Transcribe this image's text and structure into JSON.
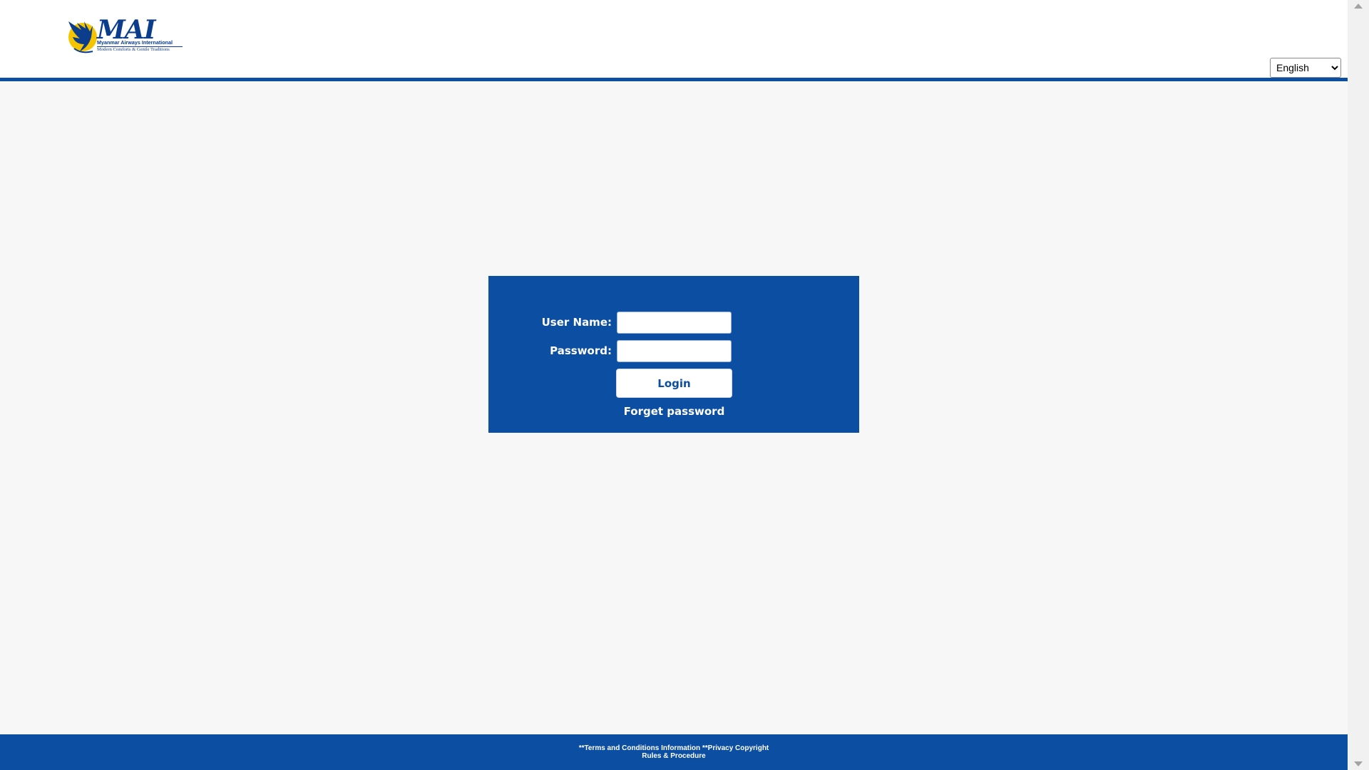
{
  "logo": {
    "wordmark": "MAI",
    "line1": "Myanmar Airways International",
    "line2": "Modern Comforts & Gentle Traditions",
    "icon": "winged-bird-logo-icon"
  },
  "language": {
    "selected": "English",
    "options": [
      "English"
    ]
  },
  "login": {
    "username_label": "User Name:",
    "password_label": "Password:",
    "username_value": "",
    "password_value": "",
    "login_label": "Login",
    "forget_label": "Forget password"
  },
  "footer": {
    "terms": "**Terms and Conditions Information",
    "privacy": "**Privacy Copyright",
    "rules": "Rules & Procedure"
  },
  "colors": {
    "brand_blue": "#0b4ea2",
    "logo_yellow": "#f5c400",
    "page_bg": "#f7f7f7"
  }
}
